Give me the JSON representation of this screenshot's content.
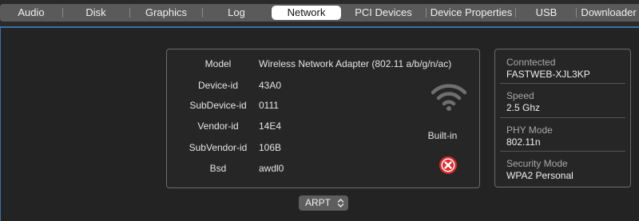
{
  "tabs": [
    {
      "label": "Audio"
    },
    {
      "label": "Disk"
    },
    {
      "label": "Graphics"
    },
    {
      "label": "Log"
    },
    {
      "label": "Network"
    },
    {
      "label": "PCI Devices"
    },
    {
      "label": "Device Properties"
    },
    {
      "label": "USB"
    },
    {
      "label": "Downloader"
    }
  ],
  "active_tab": "Network",
  "device": {
    "fields": [
      {
        "label": "Model",
        "value": "Wireless Network Adapter (802.11 a/b/g/n/ac)"
      },
      {
        "label": "Device-id",
        "value": "43A0"
      },
      {
        "label": "SubDevice-id",
        "value": "0111"
      },
      {
        "label": "Vendor-id",
        "value": "14E4"
      },
      {
        "label": "SubVendor-id",
        "value": "106B"
      },
      {
        "label": "Bsd",
        "value": "awdl0"
      }
    ],
    "status_label": "Built-in",
    "wifi_icon": "wifi-icon",
    "remove_icon": "close-circle-icon"
  },
  "connection": [
    {
      "title": "Conntected",
      "value": "FASTWEB-XJL3KP"
    },
    {
      "title": "Speed",
      "value": "2.5 Ghz"
    },
    {
      "title": "PHY Mode",
      "value": "802.11n"
    },
    {
      "title": "Security Mode",
      "value": "WPA2 Personal"
    }
  ],
  "interface_select": {
    "value": "ARPT"
  },
  "colors": {
    "accent": "#3d6fa8",
    "error": "#e0262a",
    "panel": "#232323",
    "tabbar": "#5a5a5a"
  }
}
